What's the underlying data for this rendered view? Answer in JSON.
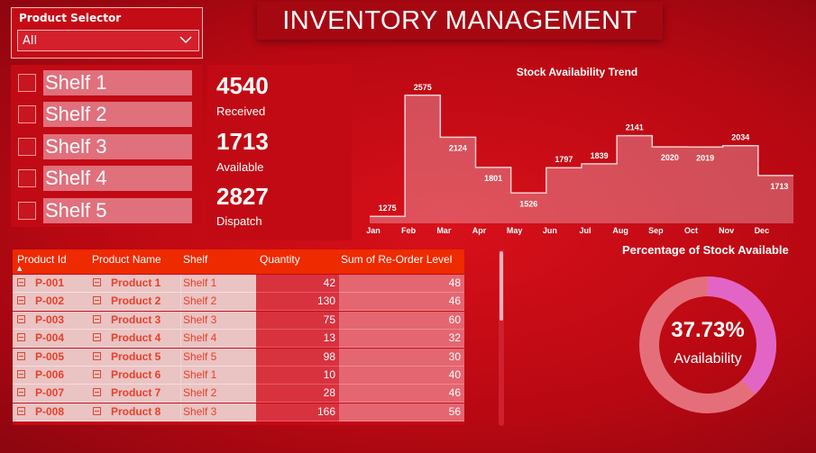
{
  "title": "INVENTORY MANAGEMENT",
  "selector": {
    "label": "Product Selector",
    "value": "All"
  },
  "shelves": [
    "Shelf 1",
    "Shelf 2",
    "Shelf 3",
    "Shelf 4",
    "Shelf 5"
  ],
  "kpis": [
    {
      "value": "4540",
      "label": "Received"
    },
    {
      "value": "1713",
      "label": "Available"
    },
    {
      "value": "2827",
      "label": "Dispatch"
    }
  ],
  "table": {
    "headers": [
      "Product Id",
      "Product Name",
      "Shelf",
      "Quantity",
      "Sum of Re-Order Level"
    ],
    "rows": [
      {
        "id": "P-001",
        "name": "Product 1",
        "shelf": "Shelf 1",
        "qty": "42",
        "reorder": "48"
      },
      {
        "id": "P-002",
        "name": "Product 2",
        "shelf": "Shelf 2",
        "qty": "130",
        "reorder": "46"
      },
      {
        "id": "P-003",
        "name": "Product 3",
        "shelf": "Shelf 3",
        "qty": "75",
        "reorder": "60"
      },
      {
        "id": "P-004",
        "name": "Product 4",
        "shelf": "Shelf 4",
        "qty": "13",
        "reorder": "32"
      },
      {
        "id": "P-005",
        "name": "Product 5",
        "shelf": "Shelf 5",
        "qty": "98",
        "reorder": "30"
      },
      {
        "id": "P-006",
        "name": "Product 6",
        "shelf": "Shelf 1",
        "qty": "10",
        "reorder": "40"
      },
      {
        "id": "P-007",
        "name": "Product 7",
        "shelf": "Shelf 2",
        "qty": "28",
        "reorder": "46"
      },
      {
        "id": "P-008",
        "name": "Product 8",
        "shelf": "Shelf 3",
        "qty": "166",
        "reorder": "56"
      }
    ]
  },
  "donut": {
    "title": "Percentage of Stock Available",
    "value_text": "37.73%",
    "label": "Availability",
    "fraction": 0.3773
  },
  "colors": {
    "accent": "#ee2a00",
    "donut_fill": "#e265c6",
    "donut_track": "#e46f7a"
  },
  "chart_data": {
    "type": "area",
    "title": "Stock Availability Trend",
    "categories": [
      "Jan",
      "Feb",
      "Mar",
      "Apr",
      "May",
      "Jun",
      "Jul",
      "Aug",
      "Sep",
      "Oct",
      "Nov",
      "Dec"
    ],
    "values": [
      1275,
      2575,
      2124,
      1801,
      1526,
      1797,
      1839,
      2141,
      2020,
      2019,
      2034,
      1713
    ],
    "ylim": [
      1200,
      2650
    ],
    "step": true,
    "grid": false
  }
}
